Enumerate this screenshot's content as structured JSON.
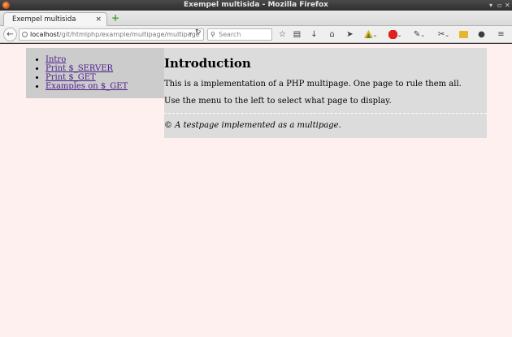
{
  "window": {
    "title": "Exempel multisida - Mozilla Firefox"
  },
  "tab": {
    "label": "Exempel multisida"
  },
  "nav": {
    "url_host": "localhost",
    "url_path": "/git/htmlphp/example/multipage/multipage",
    "search_placeholder": "Search"
  },
  "menu": {
    "items": [
      "Intro",
      "Print $_SERVER",
      "Print $_GET",
      "Examples on $_GET"
    ]
  },
  "content": {
    "title": "Introduction",
    "para1": "This is a implementation of a PHP multipage. One page to rule them all.",
    "para2": "Use the menu to the left to select what page to display.",
    "footer": "© A testpage implemented as a multipage."
  },
  "icons": [
    "bookmark-star-icon",
    "reading-list-icon",
    "download-icon",
    "home-icon",
    "send-icon",
    "colorful-addon-icon",
    "adblock-icon",
    "eyedropper-icon",
    "tools-icon",
    "screenshot-icon",
    "chat-icon",
    "hamburger-menu-icon"
  ],
  "colors": {
    "page_bg": "#fff0f0",
    "menu_bg": "#cccccc",
    "content_bg": "#dcdcdc",
    "link": "#4a1e8a"
  }
}
